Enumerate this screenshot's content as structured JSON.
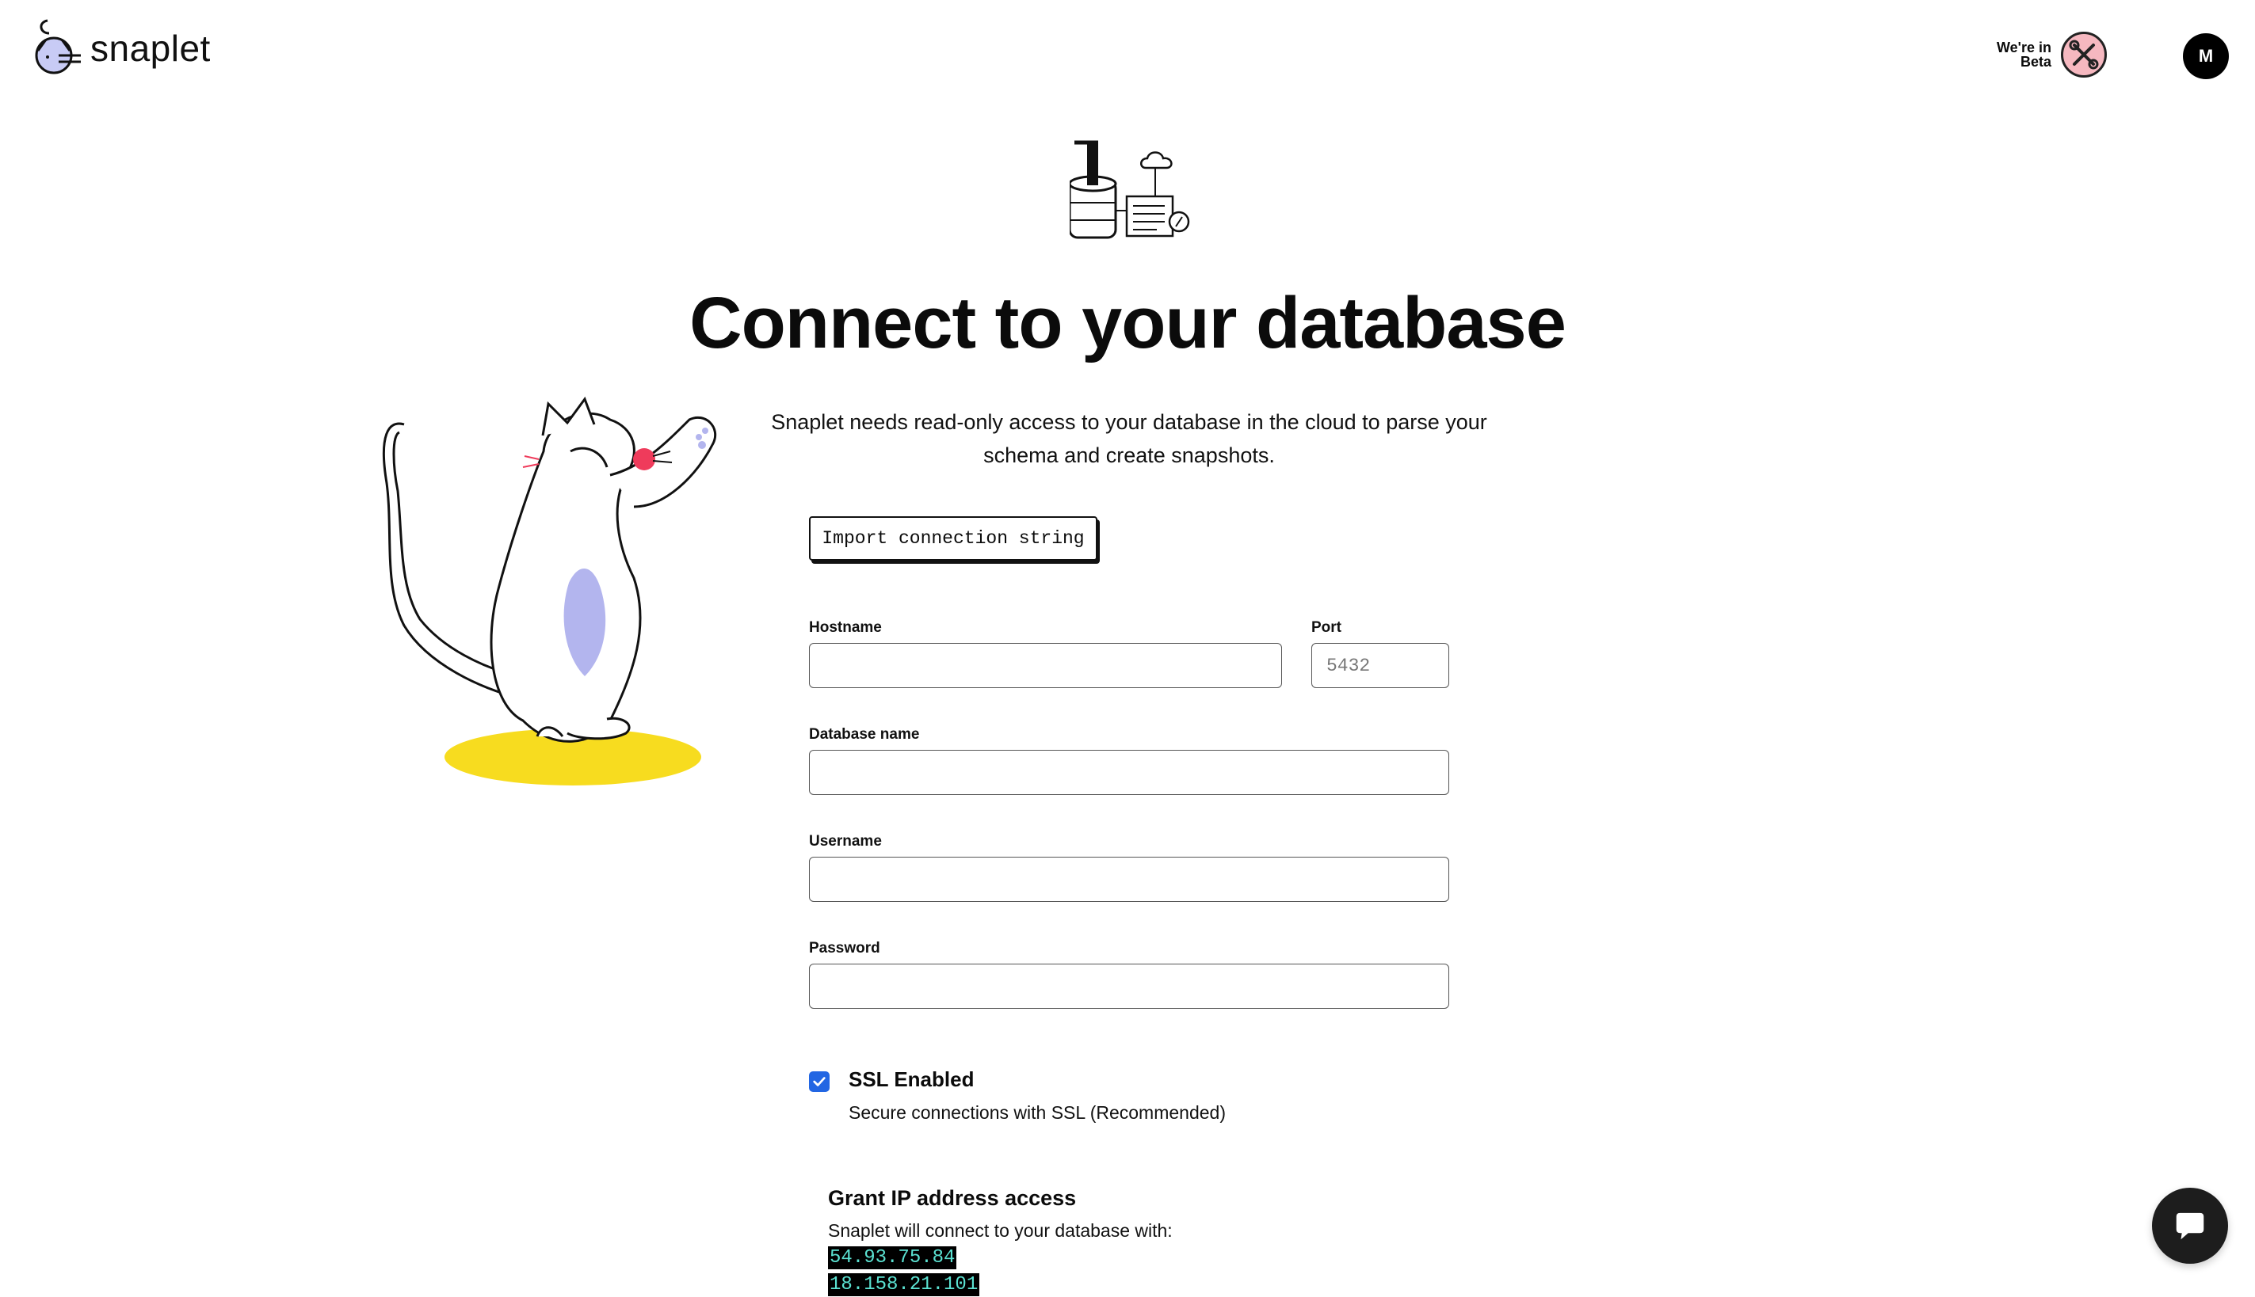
{
  "header": {
    "logo_text": "snaplet",
    "beta_line1": "We're in",
    "beta_line2": "Beta",
    "avatar_initial": "M"
  },
  "hero": {
    "title": "Connect to your database",
    "subtitle": "Snaplet needs read-only access to your database in the cloud to parse your schema and create snapshots."
  },
  "import_button": {
    "label": "Import connection string"
  },
  "form": {
    "hostname": {
      "label": "Hostname",
      "value": "",
      "placeholder": ""
    },
    "port": {
      "label": "Port",
      "value": "",
      "placeholder": "5432"
    },
    "database_name": {
      "label": "Database name",
      "value": "",
      "placeholder": ""
    },
    "username": {
      "label": "Username",
      "value": "",
      "placeholder": ""
    },
    "password": {
      "label": "Password",
      "value": "",
      "placeholder": ""
    }
  },
  "ssl": {
    "checked": true,
    "title": "SSL Enabled",
    "description": "Secure connections with SSL (Recommended)"
  },
  "grant": {
    "title": "Grant IP address access",
    "description": "Snaplet will connect to your database with:",
    "ips": [
      "54.93.75.84",
      "18.158.21.101"
    ]
  },
  "colors": {
    "accent_blue": "#2266e3",
    "cat_floor_yellow": "#f7dc1f",
    "cat_belly_lavender": "#b3b5ee",
    "ip_text_teal": "#5be2d2",
    "beta_badge_pink": "#f6b8c0"
  },
  "icons": [
    "snaplet-logo-icon",
    "beta-badge-icon",
    "database-illustration-icon",
    "cat-illustration",
    "check-icon",
    "chat-icon"
  ]
}
